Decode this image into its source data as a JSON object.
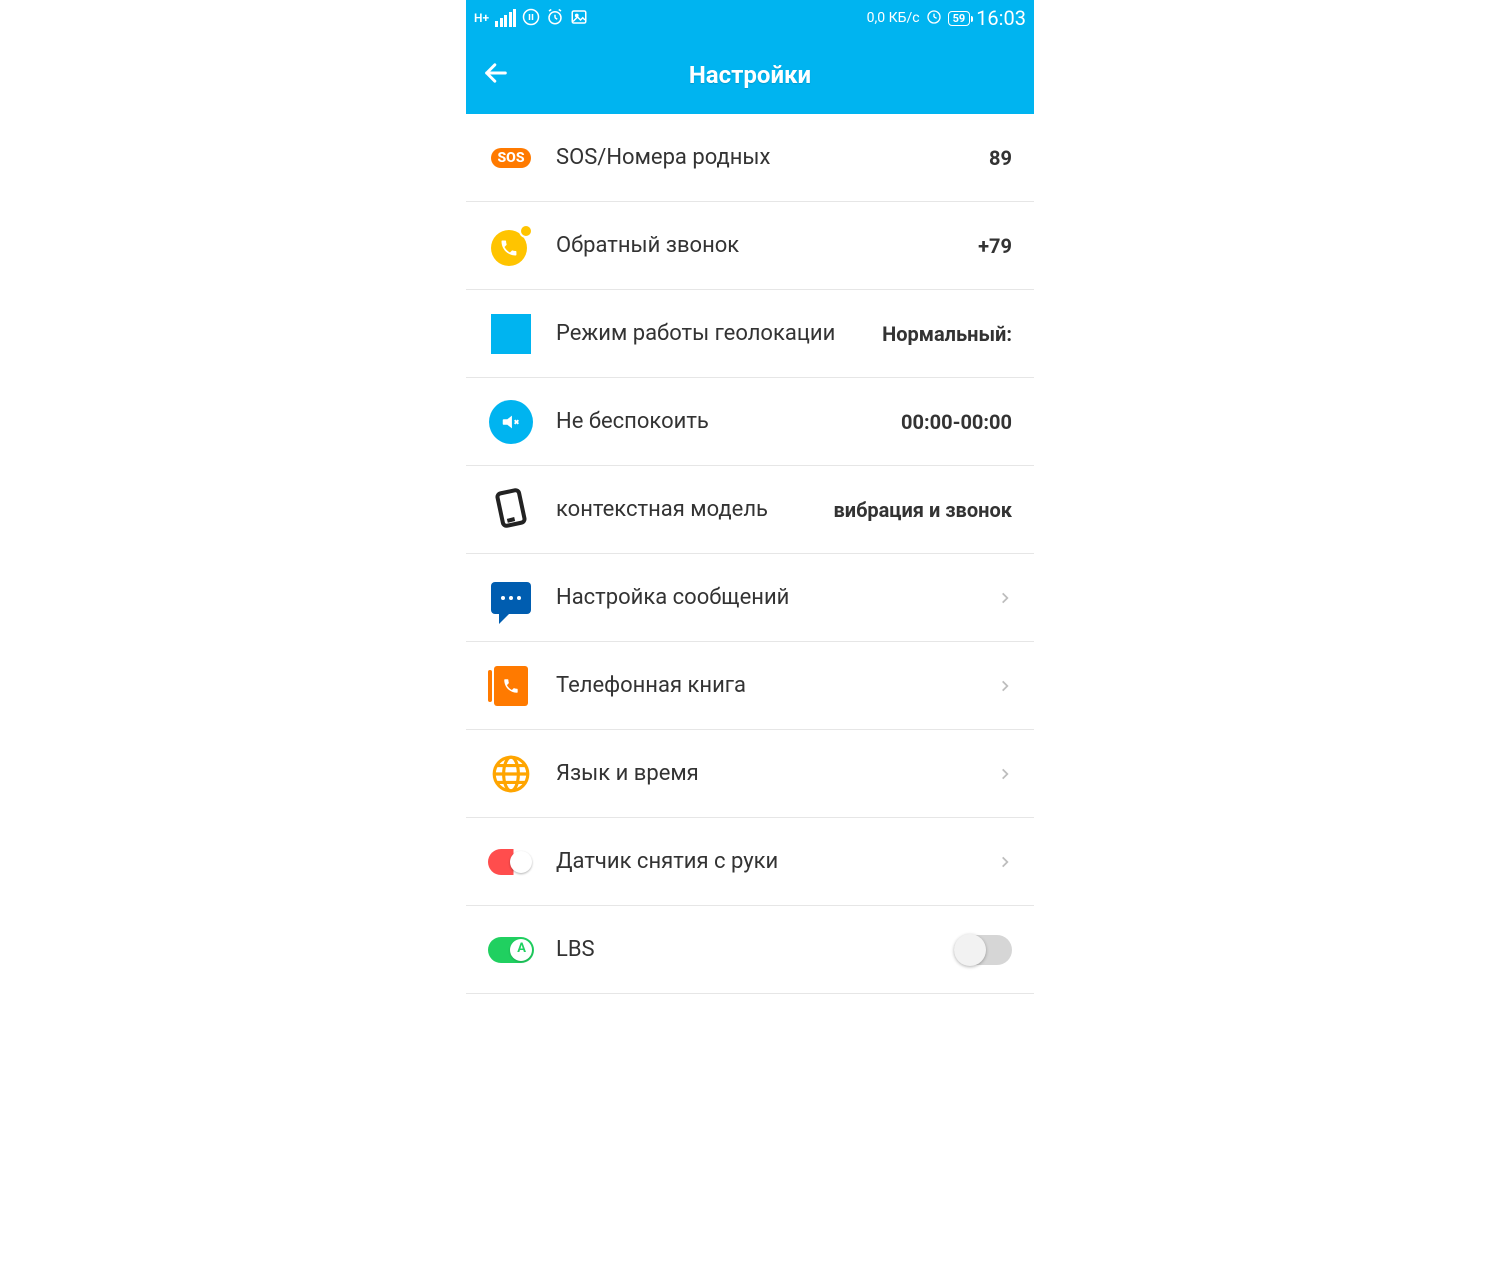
{
  "status": {
    "network_type": "H+",
    "data_rate": "0,0 КБ/с",
    "battery_text": "59",
    "time": "16:03"
  },
  "header": {
    "title": "Настройки"
  },
  "rows": {
    "sos": {
      "label": "SOS/Номера родных",
      "value": "89"
    },
    "callback": {
      "label": "Обратный звонок",
      "value": "+79"
    },
    "geo": {
      "label": "Режим работы геолокации",
      "value": "Нормальный:"
    },
    "dnd": {
      "label": "Не беспокоить",
      "value": "00:00-00:00"
    },
    "context": {
      "label": "контекстная модель",
      "value": "вибрация и звонок"
    },
    "msg": {
      "label": "Настройка сообщений"
    },
    "phbook": {
      "label": "Телефонная книга"
    },
    "lang": {
      "label": "Язык и время"
    },
    "sensor": {
      "label": "Датчик снятия с руки"
    },
    "lbs": {
      "label": "LBS"
    }
  }
}
